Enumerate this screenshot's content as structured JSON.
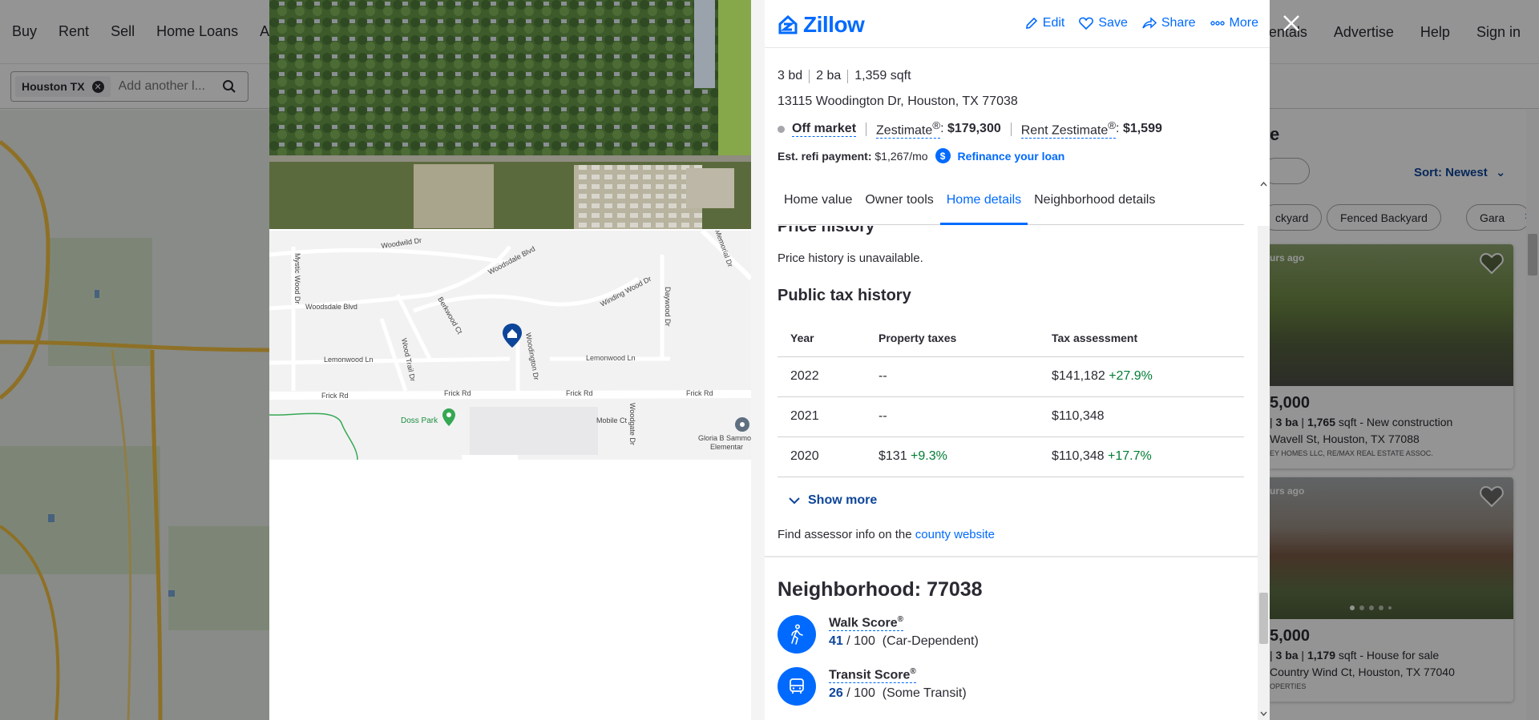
{
  "nav": {
    "left": [
      "Buy",
      "Rent",
      "Sell",
      "Home Loans",
      "Age"
    ],
    "right": [
      "Rentals",
      "Advertise",
      "Help",
      "Sign in"
    ]
  },
  "search": {
    "chip": "Houston TX",
    "placeholder": "Add another l..."
  },
  "listings": {
    "title_fragment": "e",
    "sort": "Sort: Newest",
    "filters": [
      "ckyard",
      "Fenced Backyard",
      "Gara"
    ],
    "cards": [
      {
        "badge": "urs ago",
        "price": "5,000",
        "meta_pre": "| ",
        "beds_text": "3 ba",
        "sqft": "1,765",
        "meta_post": "sqft - New construction",
        "address": "Wavell St, Houston, TX 77088",
        "broker": "EY HOMES LLC, RE/MAX REAL ESTATE ASSOC."
      },
      {
        "badge": "urs ago",
        "price": "5,000",
        "meta_pre": "| ",
        "beds_text": "3 ba",
        "sqft": "1,179",
        "meta_post": "sqft - House for sale",
        "address": "Country Wind Ct, Houston, TX 77040",
        "broker": "OPERTIES"
      }
    ]
  },
  "header": {
    "logo": "Zillow",
    "actions": [
      "Edit",
      "Save",
      "Share",
      "More"
    ]
  },
  "summary": {
    "beds": "3 bd",
    "baths": "2 ba",
    "sqft": "1,359 sqft",
    "address": "13115 Woodington Dr, Houston, TX 77038",
    "status": "Off market",
    "zestimate_label": "Zestimate",
    "zestimate_value": "$179,300",
    "rent_label": "Rent Zestimate",
    "rent_value": "$1,599",
    "refi_label": "Est. refi payment:",
    "refi_value": "$1,267/mo",
    "refi_link": "Refinance your loan"
  },
  "tabs": [
    "Home value",
    "Owner tools",
    "Home details",
    "Neighborhood details"
  ],
  "price_history": {
    "title": "Price history",
    "text": "Price history is unavailable."
  },
  "tax": {
    "title": "Public tax history",
    "headers": [
      "Year",
      "Property taxes",
      "Tax assessment"
    ],
    "rows": [
      {
        "year": "2022",
        "taxes": "--",
        "taxes_change": "",
        "assessment": "$141,182",
        "assessment_change": "+27.9%"
      },
      {
        "year": "2021",
        "taxes": "--",
        "taxes_change": "",
        "assessment": "$110,348",
        "assessment_change": ""
      },
      {
        "year": "2020",
        "taxes": "$131",
        "taxes_change": "+9.3%",
        "assessment": "$110,348",
        "assessment_change": "+17.7%"
      }
    ],
    "show_more": "Show more",
    "assessor_pre": "Find assessor info on the",
    "assessor_link": "county website"
  },
  "neighborhood": {
    "title": "Neighborhood: 77038",
    "walk": {
      "name": "Walk Score",
      "score": "41",
      "max": "/ 100",
      "desc": "(Car-Dependent)"
    },
    "transit": {
      "name": "Transit Score",
      "score": "26",
      "max": "/ 100",
      "desc": "(Some Transit)"
    }
  },
  "map_labels": {
    "streets": [
      "Woodwild Dr",
      "Woodsdale Blvd",
      "Woodsdale Blvd",
      "Winding Wood Dr",
      "Daywood Dr",
      "Mystic Wood Dr",
      "Berkwood Ct",
      "Woodington Dr",
      "Wood Trail Dr",
      "Lemonwood Ln",
      "Lemonwood Ln",
      "Frick Rd",
      "Frick Rd",
      "Frick Rd",
      "Frick Rd",
      "Mobile Ct",
      "Woodgate Dr",
      "Memorial Dr"
    ],
    "park": "Doss Park",
    "poi": "Gloria B Sammon",
    "poi2": "Elementar"
  },
  "colors": {
    "brand": "#006aff",
    "dark_link": "#0d4599",
    "positive": "#007d33"
  }
}
